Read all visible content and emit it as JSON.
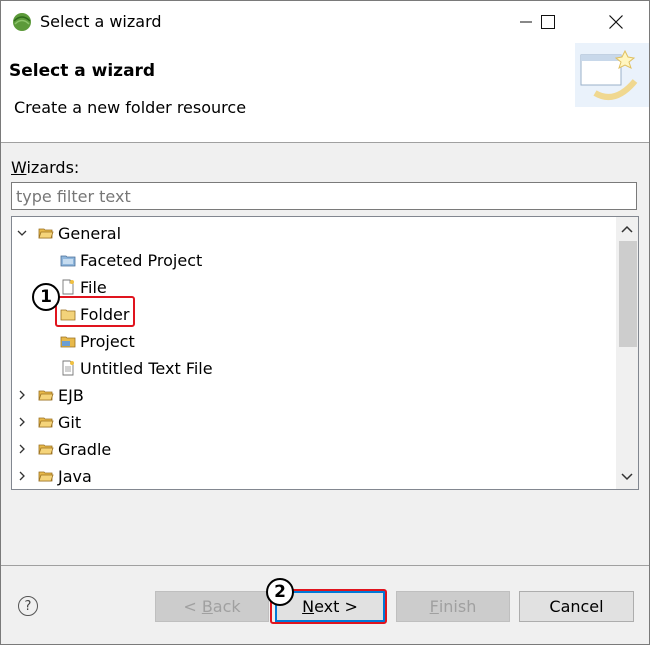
{
  "window": {
    "title": "Select a wizard",
    "minimize_glyph": "—",
    "maximize_glyph": "☐",
    "close_glyph": "✕"
  },
  "banner": {
    "title": "Select a wizard",
    "description": "Create a new folder resource",
    "icon": "wizard-banner-icon"
  },
  "wizards": {
    "label_mnemonic": "W",
    "label_rest": "izards:",
    "filter_placeholder": "type filter text",
    "filter_value": ""
  },
  "tree": {
    "items": [
      {
        "label": "General",
        "icon": "folder-open-icon",
        "expanded": true
      },
      {
        "label": "Faceted Project",
        "icon": "faceted-project-icon"
      },
      {
        "label": "File",
        "icon": "file-icon"
      },
      {
        "label": "Folder",
        "icon": "folder-icon",
        "selected": true
      },
      {
        "label": "Project",
        "icon": "project-icon"
      },
      {
        "label": "Untitled Text File",
        "icon": "text-file-icon"
      },
      {
        "label": "EJB",
        "icon": "folder-icon",
        "expanded": false
      },
      {
        "label": "Git",
        "icon": "folder-icon",
        "expanded": false
      },
      {
        "label": "Gradle",
        "icon": "folder-icon",
        "expanded": false
      },
      {
        "label": "Java",
        "icon": "folder-icon",
        "expanded": false
      }
    ]
  },
  "annotations": {
    "marker1": "1",
    "marker2": "2",
    "highlight_color": "#e0141e"
  },
  "buttons": {
    "help": "?",
    "back_prefix": "< ",
    "back_mnemonic": "B",
    "back_rest": "ack",
    "next_mnemonic": "N",
    "next_rest": "ext >",
    "finish_mnemonic": "F",
    "finish_rest": "inish",
    "cancel": "Cancel"
  },
  "colors": {
    "accent": "#0078d7",
    "folder": "#e8b94a"
  }
}
